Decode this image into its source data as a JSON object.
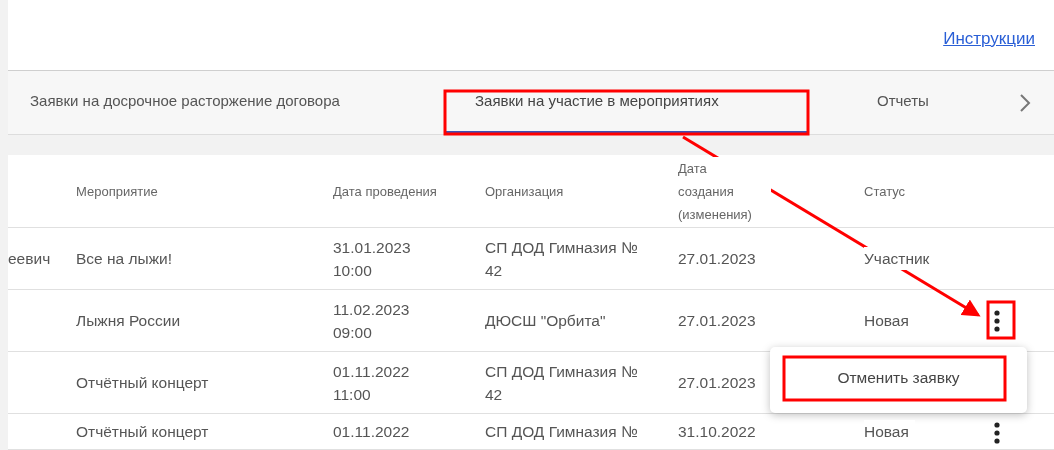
{
  "header": {
    "link": "Инструкции"
  },
  "tabs": [
    {
      "label": "Заявки на досрочное расторжение договора",
      "selected": false
    },
    {
      "label": "Заявки на участие в мероприятиях",
      "selected": true
    },
    {
      "label": "Отчеты",
      "selected": false
    }
  ],
  "table": {
    "columns": [
      "",
      "Мероприятие",
      "Дата проведения",
      "Организация",
      "Дата создания (изменения)",
      "Статус"
    ],
    "rows": [
      {
        "cells": [
          "еевич",
          "Все на лыжи!",
          "31.01.2023 10:00",
          "СП ДОД Гимназия № 42",
          "27.01.2023",
          "Участник"
        ],
        "menu_button": false
      },
      {
        "cells": [
          "",
          "Лыжня России",
          "11.02.2023 09:00",
          "ДЮСШ \"Орбита\"",
          "27.01.2023",
          "Новая"
        ],
        "menu_button": true
      },
      {
        "cells": [
          "",
          "Отчётный концерт",
          "01.11.2022 11:00",
          "СП ДОД Гимназия № 42",
          "27.01.2023",
          ""
        ],
        "menu_button": false
      },
      {
        "cells": [
          "",
          "Отчётный концерт",
          "01.11.2022",
          "СП ДОД Гимназия №",
          "31.10.2022",
          "Новая"
        ],
        "menu_button": true
      }
    ]
  },
  "row_menu": {
    "items": [
      "Отменить заявку"
    ]
  }
}
